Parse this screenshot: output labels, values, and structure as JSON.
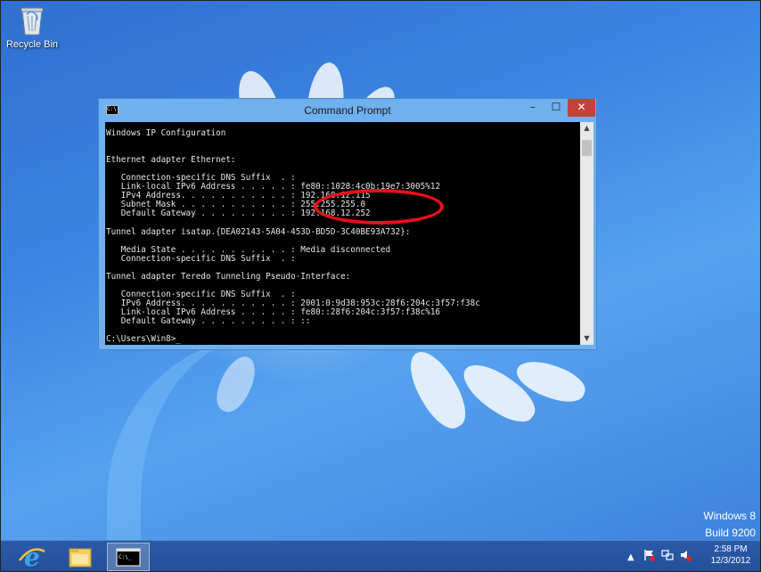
{
  "desktop": {
    "icons": [
      {
        "label": "Recycle Bin",
        "icon": "recycle-bin-icon"
      }
    ],
    "watermark": {
      "line1": "Windows 8",
      "line2": "Build 9200"
    }
  },
  "window": {
    "title": "Command Prompt",
    "icon": "console-icon",
    "buttons": {
      "minimize": "–",
      "maximize": "☐",
      "close": "✕"
    },
    "console_lines": [
      "Windows IP Configuration",
      "",
      "",
      "Ethernet adapter Ethernet:",
      "",
      "   Connection-specific DNS Suffix  . :",
      "   Link-local IPv6 Address . . . . . : fe80::1028:4c0b:19e7:3005%12",
      "   IPv4 Address. . . . . . . . . . . : 192.168.12.115",
      "   Subnet Mask . . . . . . . . . . . : 255.255.255.0",
      "   Default Gateway . . . . . . . . . : 192.168.12.252",
      "",
      "Tunnel adapter isatap.{DEA02143-5A04-453D-BD5D-3C40BE93A732}:",
      "",
      "   Media State . . . . . . . . . . . : Media disconnected",
      "   Connection-specific DNS Suffix  . :",
      "",
      "Tunnel adapter Teredo Tunneling Pseudo-Interface:",
      "",
      "   Connection-specific DNS Suffix  . :",
      "   IPv6 Address. . . . . . . . . . . : 2001:0:9d38:953c:28f6:204c:3f57:f38c",
      "   Link-local IPv6 Address . . . . . : fe80::28f6:204c:3f57:f38c%16",
      "   Default Gateway . . . . . . . . . : ::",
      "",
      "C:\\Users\\Win8>_"
    ],
    "highlight_color": "#e4101a"
  },
  "taskbar": {
    "items": [
      {
        "name": "internet-explorer",
        "icon": "internet-explorer-icon"
      },
      {
        "name": "file-explorer",
        "icon": "folder-icon"
      },
      {
        "name": "command-prompt",
        "icon": "console-icon",
        "active": true
      }
    ],
    "tray_icons": [
      "chevron-up-icon",
      "action-center-flag-icon",
      "network-icon",
      "volume-icon"
    ],
    "clock": {
      "time": "2:58 PM",
      "date": "12/3/2012"
    }
  }
}
